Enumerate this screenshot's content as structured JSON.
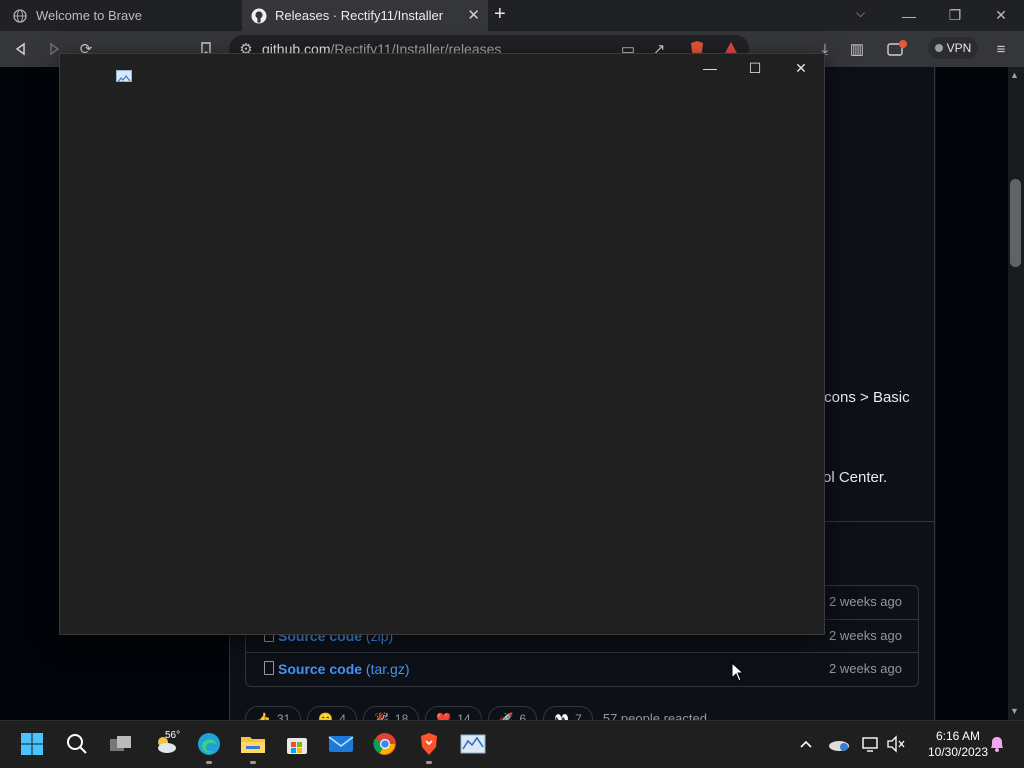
{
  "browser": {
    "tabs": [
      {
        "title": "Welcome to Brave",
        "active": false
      },
      {
        "title": "Releases · Rectify11/Installer",
        "active": true
      }
    ],
    "new_tab": "+",
    "address": {
      "host": "github.com",
      "path": "/Rectify11/Installer/releases"
    },
    "vpn_label": "VPN"
  },
  "page": {
    "fragment_line_1": "Icons > Basic",
    "fragment_line_2": "rol Center.",
    "assets": [
      {
        "name": "",
        "ext": "",
        "time": "2 weeks ago"
      },
      {
        "name": "Source code",
        "ext": "(zip)",
        "time": "2 weeks ago"
      },
      {
        "name": "Source code",
        "ext": "(tar.gz)",
        "time": "2 weeks ago"
      }
    ],
    "reactions": [
      {
        "emoji": "👍",
        "count": "31"
      },
      {
        "emoji": "😄",
        "count": "4"
      },
      {
        "emoji": "🎉",
        "count": "18"
      },
      {
        "emoji": "❤️",
        "count": "14"
      },
      {
        "emoji": "🚀",
        "count": "6"
      },
      {
        "emoji": "👀",
        "count": "7"
      }
    ],
    "people_reacted": "57 people reacted"
  },
  "app_window": {
    "icon": "chart-app-icon",
    "controls": {
      "minimize": "—",
      "maximize": "☐",
      "close": "✕"
    }
  },
  "taskbar": {
    "weather_temp": "56°",
    "clock": {
      "time": "6:16 AM",
      "date": "10/30/2023"
    }
  },
  "colors": {
    "github_bg": "#0d1117",
    "link_blue": "#4493f8",
    "app_window_bg": "#202020",
    "taskbar_bg": "#1f1f1f"
  }
}
